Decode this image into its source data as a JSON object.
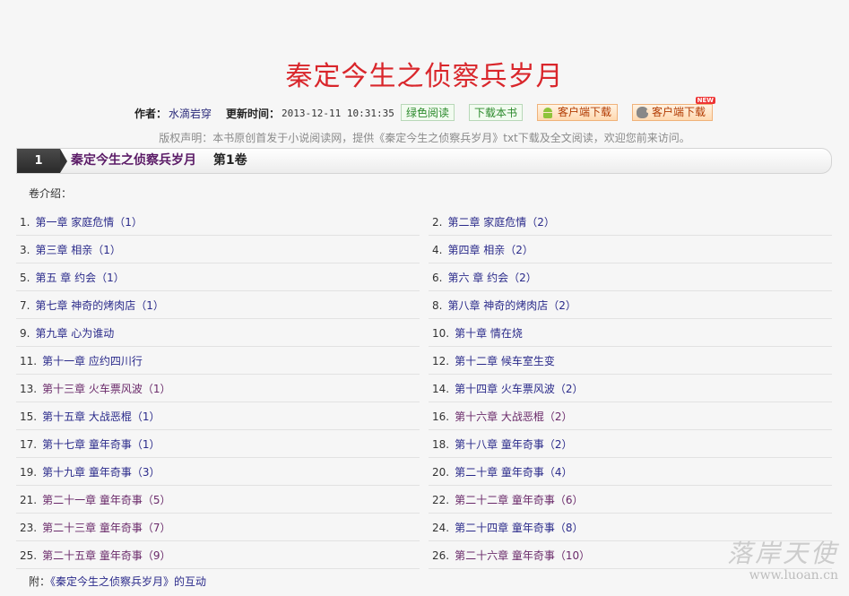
{
  "book": {
    "title": "秦定今生之侦察兵岁月",
    "author_label": "作者：",
    "author": "水滴岩穿",
    "update_label": "更新时间：",
    "update_time": "2013-12-11 10:31:35"
  },
  "buttons": {
    "green_read": "绿色阅读",
    "download_book": "下载本书",
    "android_client": "客户端下载",
    "apple_client": "客户端下载",
    "new_badge": "NEW"
  },
  "notice": "版权声明：本书原创首发于小说阅读网，提供《秦定今生之侦察兵岁月》txt下载及全文阅读，欢迎您前来访问。",
  "volume": {
    "number": "1",
    "name": "秦定今生之侦察兵岁月",
    "sub": "第1卷",
    "intro_label": "卷介绍："
  },
  "chapters": [
    {
      "no": "1.",
      "title": "第一章 家庭危情（1）"
    },
    {
      "no": "2.",
      "title": "第二章 家庭危情（2）"
    },
    {
      "no": "3.",
      "title": "第三章 相亲（1）"
    },
    {
      "no": "4.",
      "title": "第四章 相亲（2）"
    },
    {
      "no": "5.",
      "title": "第五 章 约会（1）"
    },
    {
      "no": "6.",
      "title": "第六 章 约会（2）"
    },
    {
      "no": "7.",
      "title": "第七章 神奇的烤肉店（1）"
    },
    {
      "no": "8.",
      "title": "第八章 神奇的烤肉店（2）"
    },
    {
      "no": "9.",
      "title": "第九章 心为谁动"
    },
    {
      "no": "10.",
      "title": "第十章 情在烧"
    },
    {
      "no": "11.",
      "title": "第十一章 应约四川行"
    },
    {
      "no": "12.",
      "title": "第十二章 候车室生变"
    },
    {
      "no": "13.",
      "title": "第十三章 火车票风波（1）"
    },
    {
      "no": "14.",
      "title": "第十四章 火车票风波（2）"
    },
    {
      "no": "15.",
      "title": "第十五章 大战恶棍（1）"
    },
    {
      "no": "16.",
      "title": "第十六章 大战恶棍（2）"
    },
    {
      "no": "17.",
      "title": "第十七章 童年奇事（1）"
    },
    {
      "no": "18.",
      "title": "第十八章 童年奇事（2）"
    },
    {
      "no": "19.",
      "title": "第十九章 童年奇事（3）"
    },
    {
      "no": "20.",
      "title": "第二十章 童年奇事（4）"
    },
    {
      "no": "21.",
      "title": "第二十一章 童年奇事（5）"
    },
    {
      "no": "22.",
      "title": "第二十二章 童年奇事（6）"
    },
    {
      "no": "23.",
      "title": "第二十三章 童年奇事（7）"
    },
    {
      "no": "24.",
      "title": "第二十四章 童年奇事（8）"
    },
    {
      "no": "25.",
      "title": "第二十五章 童年奇事（9）"
    },
    {
      "no": "26.",
      "title": "第二十六章 童年奇事（10）"
    }
  ],
  "footer": {
    "prefix": "附：",
    "link": "《秦定今生之侦察兵岁月》的互动"
  },
  "watermark": {
    "cn": "落岸天使",
    "url": "www.luoan.cn"
  }
}
